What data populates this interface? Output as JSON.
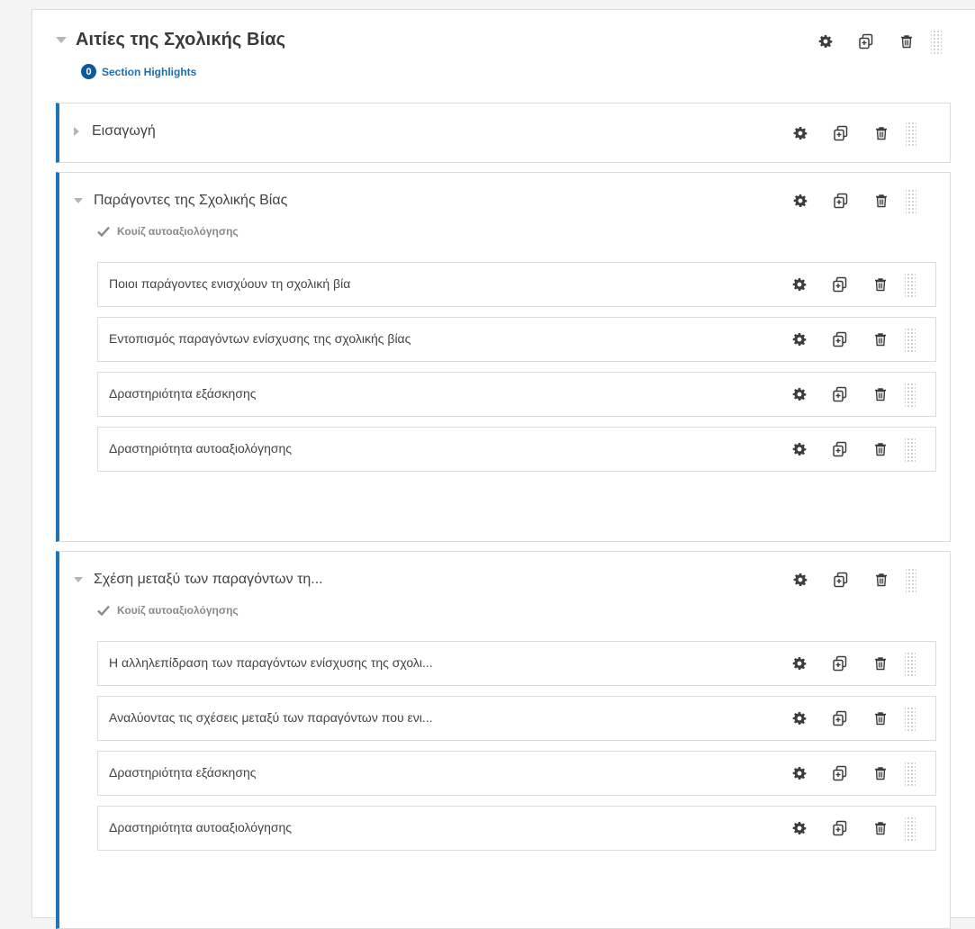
{
  "module": {
    "title": "Αιτίες της Σχολικής Βίας",
    "highlights_count": "0",
    "highlights_label": "Section Highlights"
  },
  "sections": [
    {
      "title": "Εισαγωγή",
      "expanded": false
    },
    {
      "title": "Παράγοντες της Σχολικής Βίας",
      "expanded": true,
      "quiz_label": "Κουίζ αυτοαξιολόγησης",
      "items": [
        "Ποιοι παράγοντες ενισχύουν τη σχολική βία",
        "Εντοπισμός παραγόντων ενίσχυσης της σχολικής βίας",
        "Δραστηριότητα εξάσκησης",
        "Δραστηριότητα αυτοαξιολόγησης"
      ]
    },
    {
      "title": "Σχέση μεταξύ των παραγόντων τη...",
      "expanded": true,
      "quiz_label": "Κουίζ αυτοαξιολόγησης",
      "items": [
        "Η αλληλεπίδραση των παραγόντων ενίσχυσης της σχολι...",
        "Αναλύοντας τις σχέσεις μεταξύ των παραγόντων που ενι...",
        "Δραστηριότητα εξάσκησης",
        "Δραστηριότητα αυτοαξιολόγησης"
      ]
    }
  ],
  "colors": {
    "accent": "#1b75bb",
    "badge": "#0e5a99",
    "link": "#1d6fb0",
    "icon": "#3d3d3d"
  },
  "icons": {
    "settings": "gear-icon",
    "duplicate": "duplicate-icon",
    "delete": "trash-icon",
    "drag": "drag-handle-icon",
    "quiz": "check-icon"
  }
}
